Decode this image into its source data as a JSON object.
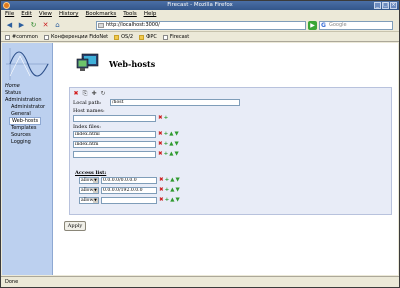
{
  "window": {
    "title": "Firecast - Mozilla Firefox"
  },
  "menu": [
    "File",
    "Edit",
    "View",
    "History",
    "Bookmarks",
    "Tools",
    "Help"
  ],
  "nav": {
    "url": "http://localhost:3000/",
    "search_placeholder": "Google"
  },
  "bookmarks": [
    "#common",
    "Конференции FidoNet",
    "OS/2",
    "ФРС",
    "Firecast"
  ],
  "sidebar": {
    "home": "Home",
    "items": [
      "Status",
      "Administration",
      "Administrator",
      "General",
      "Web-hosts",
      "Templates",
      "Sources",
      "Logging"
    ]
  },
  "page": {
    "title": "Web-hosts",
    "local_path_label": "Local path:",
    "local_path_value": "/host",
    "host_names_label": "Host names:",
    "host_name_value": "",
    "index_files_label": "Index files:",
    "index_files": [
      "index.html",
      "index.htm",
      ""
    ],
    "access_list_label": "Access list:",
    "access": [
      {
        "action": "allow",
        "address": "0.0.0.0/0.0.0.0"
      },
      {
        "action": "allow",
        "address": "0.0.0.0/192.0.0.0"
      },
      {
        "action": "allow",
        "address": ""
      }
    ],
    "apply_label": "Apply"
  },
  "status": {
    "text": "Done"
  }
}
